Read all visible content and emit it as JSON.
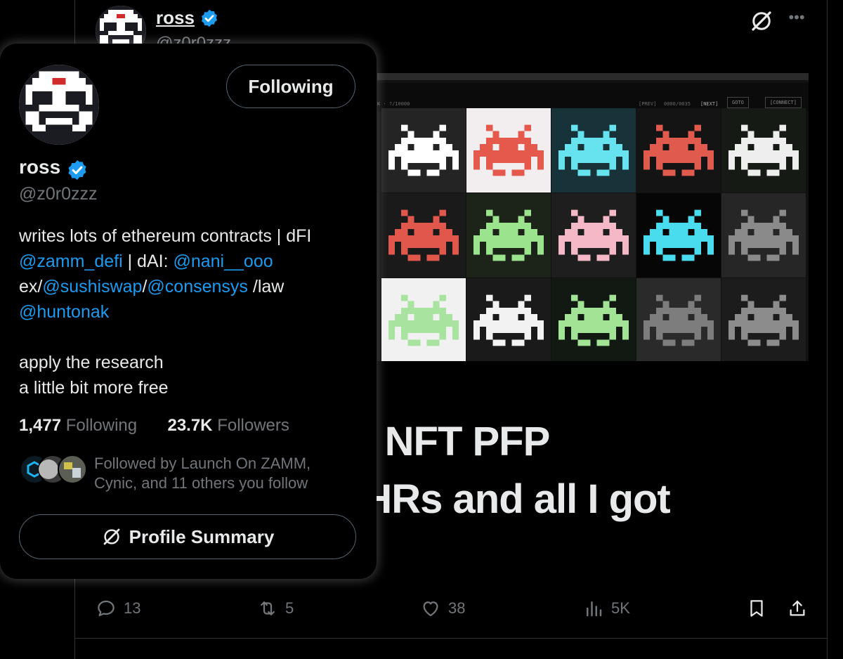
{
  "tweet": {
    "author_name": "ross",
    "author_handle": "@z0r0zzz",
    "text_line1": "0k NFT PFP",
    "text_line2": "2 HRs and all I got",
    "media_toolbar": {
      "left_text": "K  ·  ?/10000",
      "prev": "[PREV]",
      "counter": "0000/0035",
      "next": "[NEXT]",
      "goto": "GOTO",
      "connect": "[CONNECT]"
    },
    "actions": {
      "replies": "13",
      "reposts": "5",
      "likes": "38",
      "views": "5K"
    }
  },
  "hover_card": {
    "name": "ross",
    "handle": "@z0r0zzz",
    "follow_label": "Following",
    "bio": {
      "line1": "writes lots of ethereum contracts | dFI",
      "mention_zamm": "@zamm_defi",
      "sep1": " | dAI: ",
      "mention_nani": "@nani__ooo",
      "ex_prefix": "ex/",
      "mention_sushi": "@sushiswap",
      "slash": "/",
      "mention_consensys": "@consensys",
      "law_suffix": " /law",
      "mention_hunton": "@huntonak",
      "line_apply": "apply the research",
      "line_free": "a little bit more free"
    },
    "following_count": "1,477",
    "following_label": "Following",
    "followers_count": "23.7K",
    "followers_label": "Followers",
    "followed_by_line1": "Followed by Launch On ZAMM,",
    "followed_by_line2": "Cynic, and 11 others you follow",
    "summary_label": "Profile Summary"
  },
  "colors": {
    "accent_blue": "#1d9bf0",
    "muted_text": "#71767b",
    "text": "#e7e9ea",
    "background": "#000000"
  },
  "icons": [
    "verified-badge-icon",
    "grok-icon",
    "more-icon",
    "reply-icon",
    "repost-icon",
    "like-icon",
    "views-icon",
    "bookmark-icon",
    "share-icon"
  ]
}
